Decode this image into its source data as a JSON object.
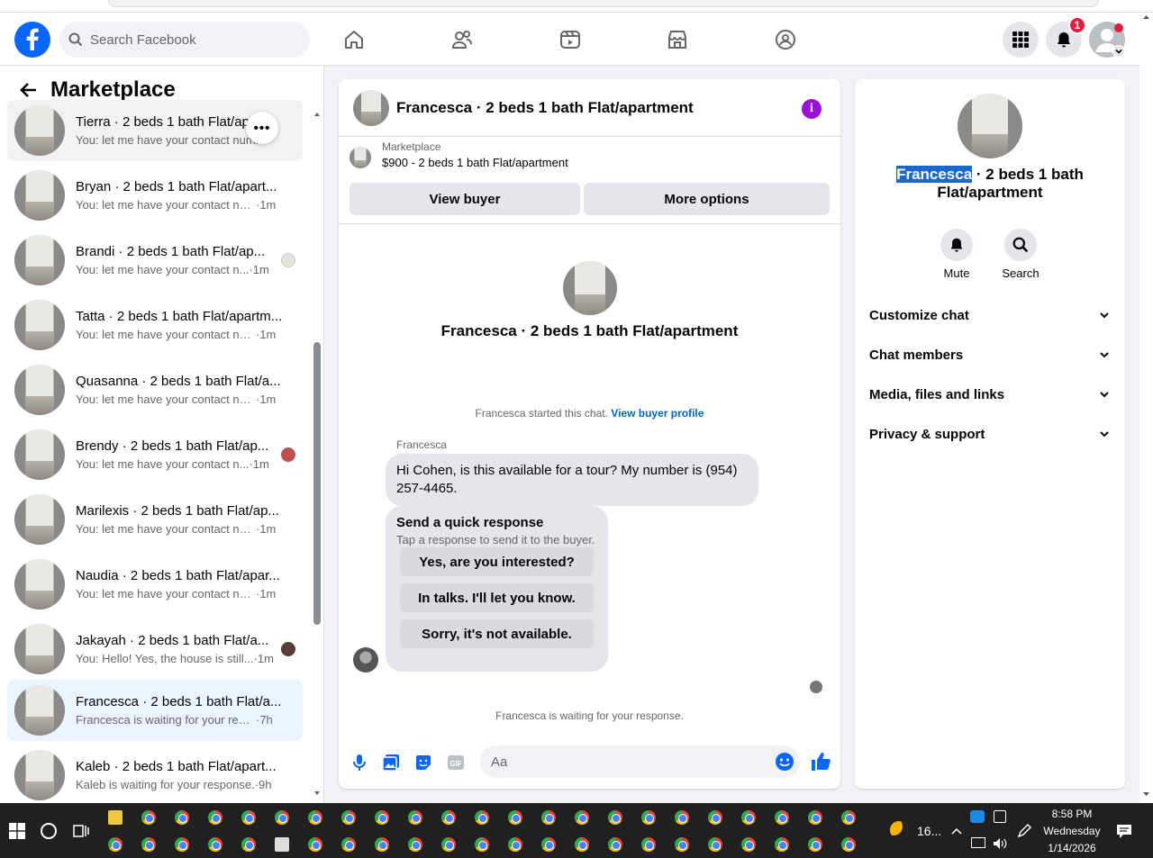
{
  "search": {
    "placeholder": "Search Facebook"
  },
  "notifications": {
    "count": "1"
  },
  "marketplace": {
    "title": "Marketplace"
  },
  "conversations": [
    {
      "name": "Tierra · 2 beds 1 bath Flat/ap",
      "message": "You: let me have your contact num",
      "time": "m"
    },
    {
      "name": "Bryan · 2 beds 1 bath Flat/apart...",
      "message": "You: let me have your contact num...",
      "time": "·1m"
    },
    {
      "name": "Brandi · 2 beds 1 bath Flat/ap...",
      "message": "You: let me have your contact n...",
      "time": "·1m"
    },
    {
      "name": "Tatta · 2 beds 1 bath Flat/apartm...",
      "message": "You: let me have your contact num...",
      "time": "·1m"
    },
    {
      "name": "Quasanna · 2 beds 1 bath Flat/a...",
      "message": "You: let me have your contact num...",
      "time": "·1m"
    },
    {
      "name": "Brendy · 2 beds 1 bath Flat/ap...",
      "message": "You: let me have your contact n...",
      "time": "·1m"
    },
    {
      "name": "Marilexis · 2 beds 1 bath Flat/ap...",
      "message": "You: let me have your contact num...",
      "time": "·1m"
    },
    {
      "name": "Naudia · 2 beds 1 bath Flat/apar...",
      "message": "You: let me have your contact num...",
      "time": "·1m"
    },
    {
      "name": "Jakayah · 2 beds 1 bath Flat/a...",
      "message": "You: Hello! Yes, the house is still...",
      "time": "·1m"
    },
    {
      "name": "Francesca · 2 beds 1 bath Flat/a...",
      "message": "Francesca is waiting for your resp...",
      "time": "·7h"
    },
    {
      "name": "Kaleb · 2 beds 1 bath Flat/apart...",
      "message": "Kaleb is waiting for your response.",
      "time": "·9h"
    }
  ],
  "chat": {
    "title": "Francesca · 2 beds 1 bath Flat/apartment",
    "marketplace_label": "Marketplace",
    "listing": "$900 - 2 beds 1 bath Flat/apartment",
    "view_buyer": "View buyer",
    "more_options": "More options",
    "center_title": "Francesca · 2 beds 1 bath Flat/apartment",
    "started_text": "Francesca started this chat.",
    "view_profile": "View buyer profile",
    "sender": "Francesca",
    "message": "Hi Cohen, is this available for a tour? My number is (954) 257-4465.",
    "quick_title": "Send a quick response",
    "quick_sub": "Tap a response to send it to the buyer.",
    "quick_options": [
      "Yes, are you interested?",
      "In talks. I'll let you know.",
      "Sorry, it's not available."
    ],
    "waiting": "Francesca is waiting for your response.",
    "composer_placeholder": "Aa"
  },
  "details": {
    "name_highlight": "Francesca",
    "name_rest": " · 2 beds 1 bath Flat/apartment",
    "mute": "Mute",
    "search": "Search",
    "sections": [
      "Customize chat",
      "Chat members",
      "Media, files and links",
      "Privacy & support"
    ]
  },
  "taskbar": {
    "weather": "16...",
    "time": "8:58 PM",
    "day": "Wednesday",
    "date": "1/14/2026"
  },
  "colors": {
    "brand": "#0866ff",
    "info": "#9b10d9",
    "highlight": "#1967d2"
  }
}
